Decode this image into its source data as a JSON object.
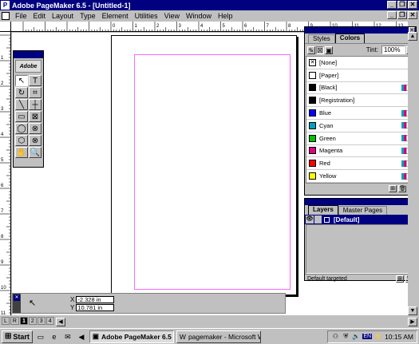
{
  "window": {
    "title": "Adobe PageMaker 6.5 - [Untitled-1]"
  },
  "menu": [
    "File",
    "Edit",
    "Layout",
    "Type",
    "Element",
    "Utilities",
    "View",
    "Window",
    "Help"
  ],
  "ruler_top_labels": [
    "0",
    "1",
    "2",
    "3",
    "4",
    "5",
    "6",
    "7",
    "8",
    "9",
    "10",
    "11",
    "12",
    "13"
  ],
  "ruler_left_labels": [
    "1",
    "2",
    "3",
    "4",
    "5",
    "6",
    "7",
    "8",
    "9",
    "10",
    "11"
  ],
  "toolbox": {
    "logo": "Adobe",
    "tools": [
      {
        "name": "pointer-tool",
        "glyph": "↖",
        "selected": true
      },
      {
        "name": "text-tool",
        "glyph": "T"
      },
      {
        "name": "rotate-tool",
        "glyph": "↻"
      },
      {
        "name": "crop-tool",
        "glyph": "⌗"
      },
      {
        "name": "line-tool",
        "glyph": "╲"
      },
      {
        "name": "constrained-line-tool",
        "glyph": "┼"
      },
      {
        "name": "rectangle-tool",
        "glyph": "▭"
      },
      {
        "name": "rectangle-frame-tool",
        "glyph": "⊠"
      },
      {
        "name": "ellipse-tool",
        "glyph": "◯"
      },
      {
        "name": "ellipse-frame-tool",
        "glyph": "⊗"
      },
      {
        "name": "polygon-tool",
        "glyph": "⬡"
      },
      {
        "name": "polygon-frame-tool",
        "glyph": "⊗"
      },
      {
        "name": "hand-tool",
        "glyph": "✋"
      },
      {
        "name": "zoom-tool",
        "glyph": "🔍"
      }
    ]
  },
  "colors_palette": {
    "tabs": [
      "Styles",
      "Colors"
    ],
    "active_tab": "Colors",
    "tint_label": "Tint:",
    "tint_value": "100%",
    "colors": [
      {
        "name": "[None]",
        "swatch": "#ffffff",
        "none": true
      },
      {
        "name": "[Paper]",
        "swatch": "#ffffff"
      },
      {
        "name": "[Black]",
        "swatch": "#000000",
        "icon": true
      },
      {
        "name": "[Registration]",
        "swatch": "#000000"
      },
      {
        "name": "Blue",
        "swatch": "#0000ff",
        "icon": true
      },
      {
        "name": "Cyan",
        "swatch": "#00a0c0",
        "icon": true
      },
      {
        "name": "Green",
        "swatch": "#00c000",
        "icon": true
      },
      {
        "name": "Magenta",
        "swatch": "#e00080",
        "icon": true
      },
      {
        "name": "Red",
        "swatch": "#ff0000",
        "icon": true
      },
      {
        "name": "Yellow",
        "swatch": "#ffff00",
        "icon": true
      }
    ]
  },
  "layers_palette": {
    "tabs": [
      "Layers",
      "Master Pages"
    ],
    "active_tab": "Layers",
    "layers": [
      "[Default]"
    ],
    "status": "Default targeted"
  },
  "control_palette": {
    "x_label": "X",
    "x_value": "-2.328 in",
    "y_label": "Y",
    "y_value": "10.781 in"
  },
  "page_tabs": [
    "L",
    "R",
    "1",
    "2",
    "3",
    "4"
  ],
  "active_page": "1",
  "taskbar": {
    "start": "Start",
    "tasks": [
      {
        "label": "Adobe PageMaker 6.5 ...",
        "active": true
      },
      {
        "label": "pagemaker - Microsoft Word",
        "active": false
      }
    ],
    "language": "EN",
    "clock": "10:15 AM"
  }
}
